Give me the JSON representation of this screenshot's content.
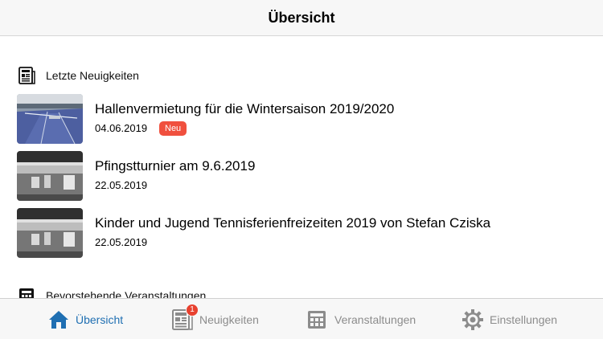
{
  "header": {
    "title": "Übersicht"
  },
  "sections": {
    "news": {
      "title": "Letzte Neuigkeiten",
      "icon": "newspaper-icon"
    },
    "events": {
      "title": "Bevorstehende Veranstaltungen",
      "icon": "calendar-icon"
    }
  },
  "news": [
    {
      "title": "Hallenvermietung für die Wintersaison 2019/2020",
      "date": "04.06.2019",
      "badge": "Neu"
    },
    {
      "title": "Pfingstturnier am 9.6.2019",
      "date": "22.05.2019"
    },
    {
      "title": "Kinder und Jugend Tennisferienfreizeiten 2019 von Stefan Cziska",
      "date": "22.05.2019"
    }
  ],
  "tabs": [
    {
      "label": "Übersicht",
      "icon": "home-icon",
      "active": true
    },
    {
      "label": "Neuigkeiten",
      "icon": "newspaper-icon",
      "badge": "1"
    },
    {
      "label": "Veranstaltungen",
      "icon": "calendar-icon"
    },
    {
      "label": "Einstellungen",
      "icon": "gear-icon"
    }
  ],
  "colors": {
    "accent": "#1f6fb2",
    "badge": "#f0503e",
    "inactive": "#8c8c8c"
  }
}
